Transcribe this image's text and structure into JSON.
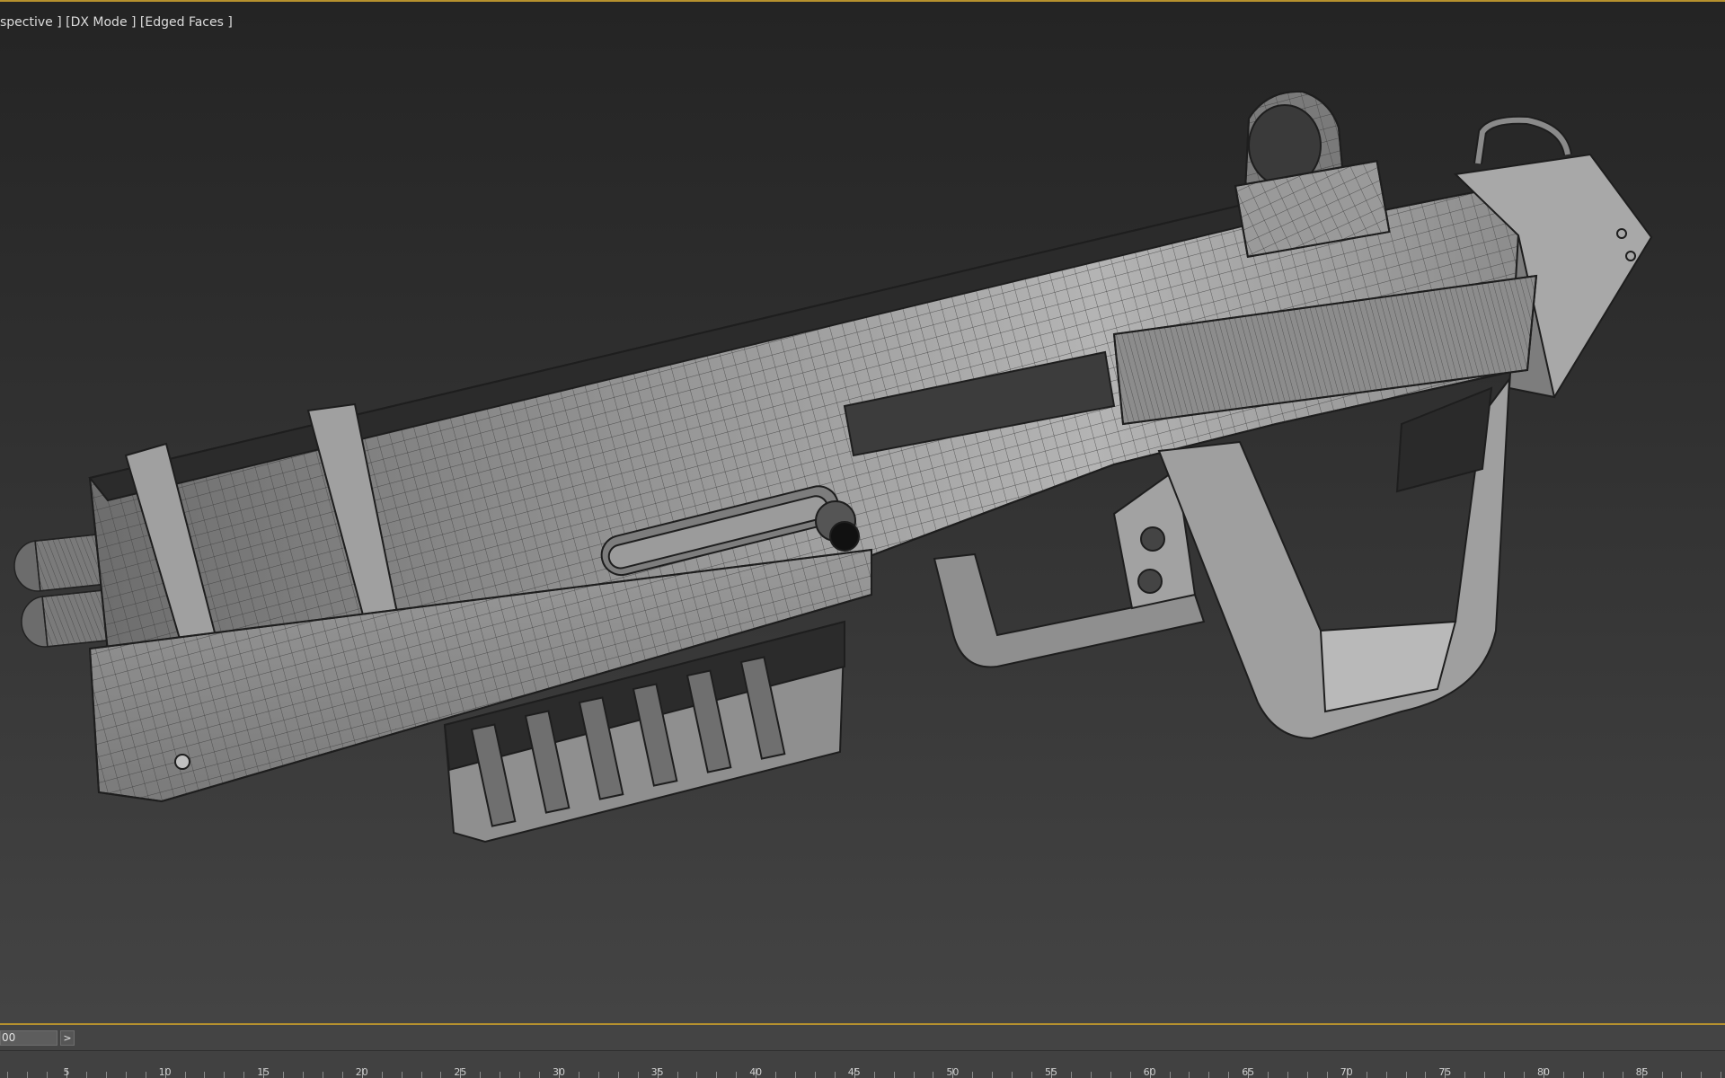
{
  "viewport": {
    "label": "spective ] [DX Mode ] [Edged Faces ]"
  },
  "time_slider": {
    "frame_value": "00",
    "next_label": ">"
  },
  "timeline": {
    "tick_labels": [
      "5",
      "10",
      "15",
      "20",
      "25",
      "30",
      "35",
      "40",
      "45",
      "50",
      "55",
      "60",
      "65",
      "70",
      "75",
      "80",
      "85"
    ]
  },
  "colors": {
    "active_viewport_border": "#b6912e",
    "viewport_bg_top": "#242424",
    "viewport_bg_bottom": "#444444",
    "model_shade": "#8a8a8a"
  }
}
